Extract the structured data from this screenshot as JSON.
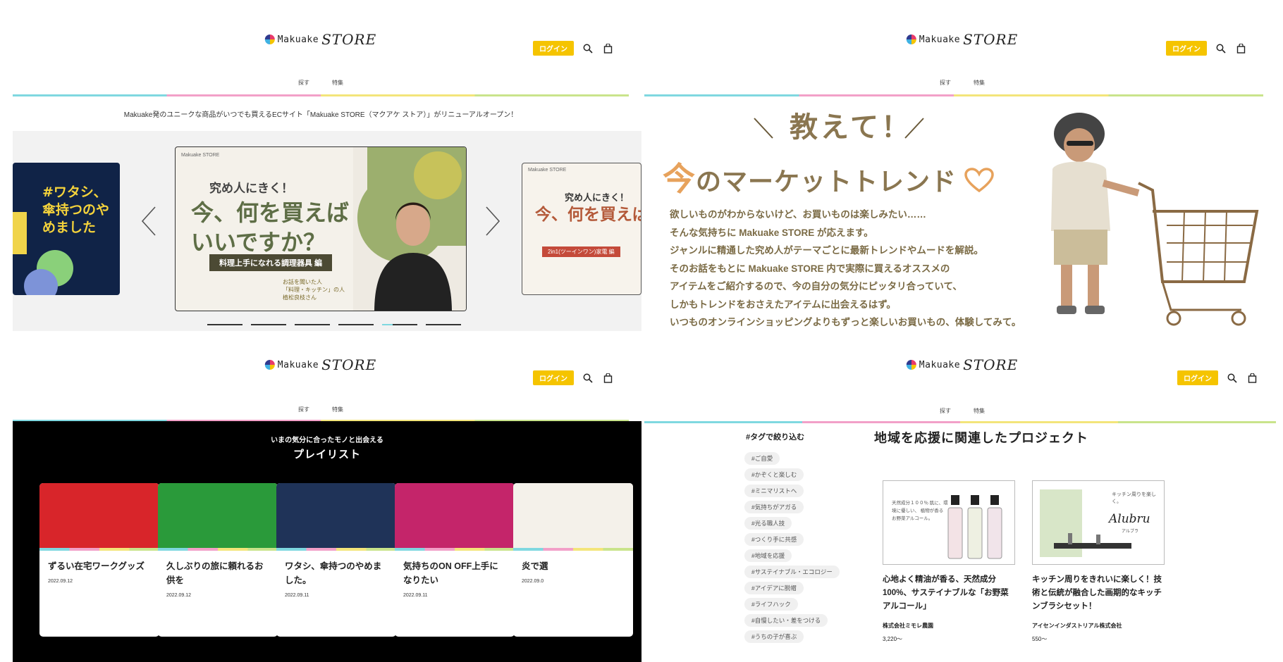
{
  "header": {
    "logo_text": "Makuake",
    "logo_store": "STORE",
    "login_label": "ログイン",
    "nav": [
      "探す",
      "特集"
    ]
  },
  "colors": {
    "accent": "#f5c400",
    "stripe": [
      "#7fd8e0",
      "#f2a0c8",
      "#f3e57a",
      "#c9e48b"
    ]
  },
  "top_left": {
    "announcement": "Makuake発のユニークな商品がいつでも買えるECサイト「Makuake STORE（マクアケ ストア）」がリニューアルオープン！",
    "carousel": {
      "left_slide": "#ワタシ、傘持つのやめました",
      "main_slide": {
        "logo": "Makuake STORE",
        "kicker": "究め人にきく！",
        "headline": "今、何を買えばいいですか？",
        "band": "料理上手になれる調理器具 編",
        "note_1": "お話を聞いた人",
        "note_2": "「料理・キッチン」の人",
        "note_3": "植松良枝さん"
      },
      "right_slide": {
        "logo": "Makuake STORE",
        "kicker": "究め人にきく！",
        "headline": "今、何を買えば いいです",
        "band": "2in1(ツーインワン)家電 編"
      },
      "dot_count": 6,
      "active_dot": 4
    }
  },
  "top_right": {
    "title_1": "教えて！",
    "title_2_now": "今",
    "title_2_rest": "のマーケットトレンド",
    "body": [
      "欲しいものがわからないけど、お買いものは楽しみたい……",
      "そんな気持ちに Makuake STORE が応えます。",
      "ジャンルに精通した究め人がテーマごとに最新トレンドやムードを解説。",
      "そのお話をもとに Makuake STORE 内で実際に買えるオススメの",
      "アイテムをご紹介するので、今の自分の気分にピッタリ合っていて、",
      "しかもトレンドをおさえたアイテムに出会えるはず。",
      "いつものオンラインショッピングよりもずっと楽しいお買いもの、体験してみて。"
    ]
  },
  "bottom_left": {
    "subtitle": "いまの気分に合ったモノと出会える",
    "title": "プレイリスト",
    "cards": [
      {
        "title": "ずるい在宅ワークグッズ",
        "date": "2022.09.12",
        "color": "#d8252a"
      },
      {
        "title": "久しぶりの旅に頼れるお供を",
        "date": "2022.09.12",
        "color": "#2a9a3a"
      },
      {
        "title": "ワタシ、傘持つのやめました。",
        "date": "2022.09.11",
        "color": "#1f3358"
      },
      {
        "title": "気持ちのON OFF上手になりたい",
        "date": "2022.09.11",
        "color": "#c4256a"
      },
      {
        "title": "炎で選",
        "date": "2022.09.0",
        "color": "#f4f1ea"
      }
    ]
  },
  "bottom_right": {
    "tag_heading": "#タグで絞り込む",
    "tags": [
      "#ご自愛",
      "#かぞくと楽しむ",
      "#ミニマリストへ",
      "#気持ちがアガる",
      "#光る職人技",
      "#つくり手に共感",
      "#地域を応援",
      "#サステイナブル・エコロジー",
      "#アイデアに脱帽",
      "#ライフハック",
      "#自慢したい・差をつける",
      "#うちの子が喜ぶ"
    ],
    "title": "地域を応援に関連したプロジェクト",
    "projects": [
      {
        "title": "心地よく精油が香る、天然成分100%、サステイナブルな「お野菜アルコール」",
        "maker": "株式会社ミモレ農園",
        "price": "3,220〜",
        "img_text": "天然成分１００％ 肌に、環境に優しい、 植物が香る お野菜アルコール。"
      },
      {
        "title": "キッチン周りをきれいに楽しく！技術と伝統が融合した画期的なキッチンブラシセット！",
        "maker": "アイセンインダストリアル株式会社",
        "price": "550〜",
        "img_text": "キッチン周りを楽しく。",
        "brand": "Alubru",
        "brand_kana": "アルブラ"
      }
    ]
  }
}
